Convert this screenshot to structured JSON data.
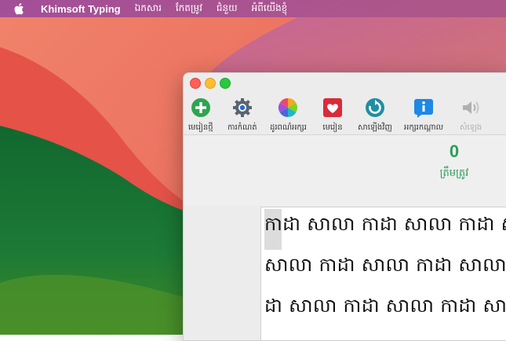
{
  "menubar": {
    "app_name": "Khimsoft Typing",
    "items": [
      "ឯកសារ",
      "កែតម្រូវ",
      "ជំនួយ",
      "អំពីយើងខ្ញុំ"
    ]
  },
  "toolbar": {
    "buttons": [
      {
        "label": "មេរៀនថ្មី",
        "icon": "plus-circle-icon",
        "color": "#2fa44f"
      },
      {
        "label": "ការកំណត់",
        "icon": "gear-icon",
        "color": "#5a6470"
      },
      {
        "label": "ដូរពណ៌អក្សរ",
        "icon": "color-wheel-icon",
        "color": "#e84b6a"
      },
      {
        "label": "មេរៀន",
        "icon": "heart-icon",
        "color": "#d92b3a"
      },
      {
        "label": "សាឡើងវិញ",
        "icon": "refresh-icon",
        "color": "#1f8ea3"
      },
      {
        "label": "អក្សរកណ្ដាល",
        "icon": "info-icon",
        "color": "#1e88e5"
      },
      {
        "label": "សំឡេង",
        "icon": "speaker-icon",
        "color": "#b0b0b0"
      }
    ]
  },
  "stats": {
    "correct_count": "0",
    "correct_label": "ត្រឹមត្រូវ"
  },
  "lesson": {
    "lines": [
      "កាដា សាលា កាដា សាលា កាដា ស",
      "សាលា កាដា សាលា កាដា សាលា",
      "ដា សាលា កាដា សាលា កាដា សា"
    ]
  },
  "colors": {
    "accent_green": "#2f9c5c"
  }
}
